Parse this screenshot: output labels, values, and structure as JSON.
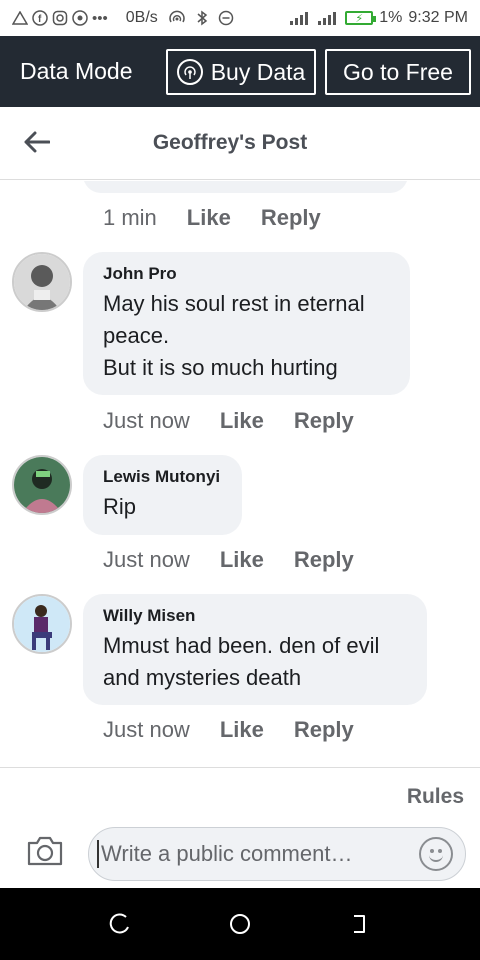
{
  "status_bar": {
    "speed": "0B/s",
    "battery_percent": "1%",
    "time": "9:32 PM"
  },
  "data_bar": {
    "mode_label": "Data Mode",
    "buy_label": "Buy Data",
    "free_label": "Go to Free"
  },
  "header": {
    "title": "Geoffrey's Post"
  },
  "previous_comment": {
    "time": "1 min",
    "like": "Like",
    "reply": "Reply"
  },
  "comments": [
    {
      "author": "John Pro",
      "text": "May his soul rest in eternal\npeace.\nBut it is so much hurting",
      "time": "Just now",
      "like": "Like",
      "reply": "Reply"
    },
    {
      "author": "Lewis Mutonyi",
      "text": "Rip",
      "time": "Just now",
      "like": "Like",
      "reply": "Reply"
    },
    {
      "author": "Willy Misen",
      "text": "Mmust had been. den of evil\nand mysteries death",
      "time": "Just now",
      "like": "Like",
      "reply": "Reply"
    }
  ],
  "footer": {
    "rules_label": "Rules",
    "comment_placeholder": "Write a public comment…"
  },
  "colors": {
    "data_bar_bg": "#232a33",
    "bubble_bg": "#f0f2f5",
    "secondary_text": "#65676b"
  }
}
